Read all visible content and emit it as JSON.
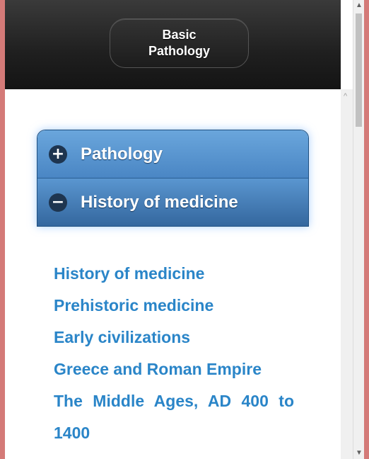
{
  "header": {
    "title": "Basic\nPathology"
  },
  "accordion": [
    {
      "label": "Pathology",
      "icon": "+",
      "state": "collapsed"
    },
    {
      "label": "History of medicine",
      "icon": "−",
      "state": "expanded"
    }
  ],
  "links": [
    "History of medicine",
    "Prehistoric medicine",
    "Early civilizations",
    "Greece and Roman Empire",
    "The Middle Ages, AD 400 to 1400"
  ],
  "scrollbar": {
    "up_arrow": "▲",
    "down_arrow": "▼",
    "inner_up_arrow": "^"
  }
}
